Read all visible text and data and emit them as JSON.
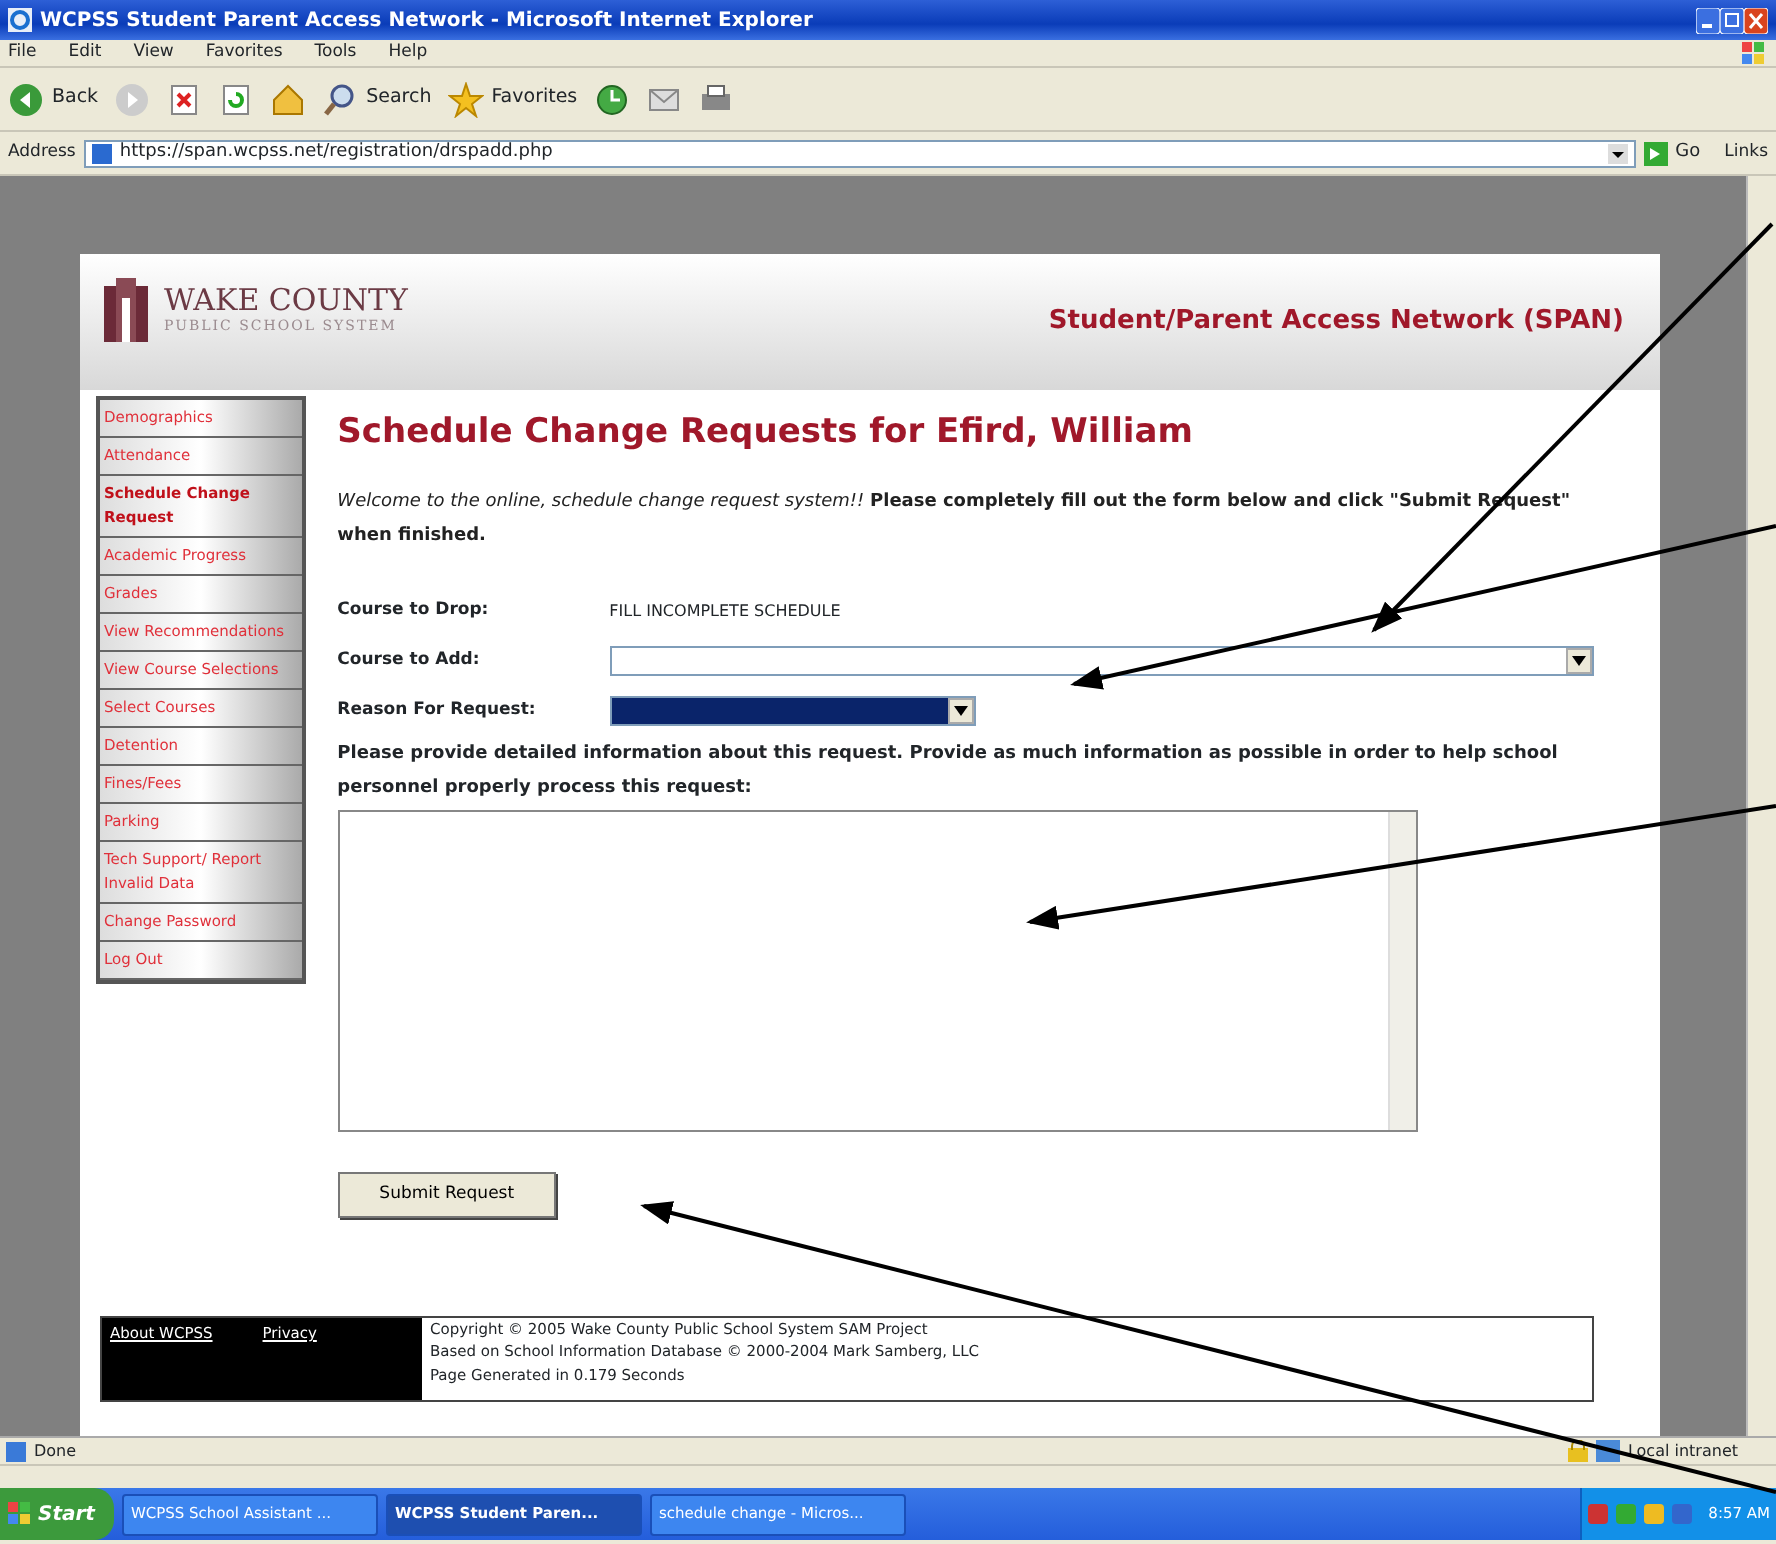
{
  "window": {
    "title": "WCPSS Student Parent Access Network - Microsoft Internet Explorer"
  },
  "menu": [
    "File",
    "Edit",
    "View",
    "Favorites",
    "Tools",
    "Help"
  ],
  "toolbar": [
    {
      "kind": "back",
      "label": "Back"
    },
    {
      "kind": "forward"
    },
    {
      "kind": "stop"
    },
    {
      "kind": "refresh"
    },
    {
      "kind": "home"
    },
    {
      "kind": "search",
      "label": "Search"
    },
    {
      "kind": "favorites",
      "label": "Favorites"
    },
    {
      "kind": "history"
    },
    {
      "kind": "mail"
    },
    {
      "kind": "print"
    }
  ],
  "address_bar": {
    "label": "Address",
    "url": "https://span.wcpss.net/registration/drspadd.php",
    "go": "Go",
    "links": "Links"
  },
  "page": {
    "logo": {
      "name": "WAKE COUNTY",
      "subtitle": "PUBLIC SCHOOL SYSTEM"
    },
    "banner": "Student/Parent Access Network (SPAN)",
    "nav": [
      {
        "label": "Demographics",
        "selected": false
      },
      {
        "label": "Attendance",
        "selected": false
      },
      {
        "label": "Schedule Change Request",
        "selected": true
      },
      {
        "label": "Academic Progress",
        "selected": false
      },
      {
        "label": "Grades",
        "selected": false
      },
      {
        "label": "View Recommendations",
        "selected": false
      },
      {
        "label": "View Course Selections",
        "selected": false
      },
      {
        "label": "Select Courses",
        "selected": false
      },
      {
        "label": "Detention",
        "selected": false
      },
      {
        "label": "Fines/Fees",
        "selected": false
      },
      {
        "label": "Parking",
        "selected": false
      },
      {
        "label": "Tech Support/ Report Invalid Data",
        "selected": false
      },
      {
        "label": "Change Password",
        "selected": false
      },
      {
        "label": "Log Out",
        "selected": false
      }
    ],
    "heading": "Schedule Change Requests for Efird, William",
    "intro": "*Welcome to the online, schedule change request system!!* **Please completely fill out the form below and click \"Submit Request\" when finished.**",
    "fields": [
      {
        "kind": "text",
        "label": "Course to Drop:",
        "value": "FILL INCOMPLETE SCHEDULE"
      },
      {
        "kind": "select",
        "label": "Course to Add:",
        "focused": false
      },
      {
        "kind": "select",
        "label": "Reason For Request:",
        "focused": true
      }
    ],
    "details_prompt": "Please provide detailed information about this request. Provide as much information as possible in order to help school personnel properly process this request:",
    "submit": "Submit Request",
    "footer": {
      "links": [
        "About WCPSS",
        "Privacy"
      ],
      "lines": [
        "Copyright © 2005 Wake County Public School System SAM Project",
        "Based on School Information Database © 2000-2004 Mark Samberg, LLC",
        "Page Generated in 0.179 Seconds"
      ]
    }
  },
  "status_bar": {
    "text": "Done",
    "zone": "Local intranet"
  },
  "taskbar": {
    "start": "Start",
    "tasks": [
      {
        "label": "WCPSS School Assistant ...",
        "selected": false
      },
      {
        "label": "WCPSS Student Paren...",
        "selected": true
      },
      {
        "label": "schedule change - Micros...",
        "selected": false
      }
    ],
    "clock": "8:57 AM"
  }
}
